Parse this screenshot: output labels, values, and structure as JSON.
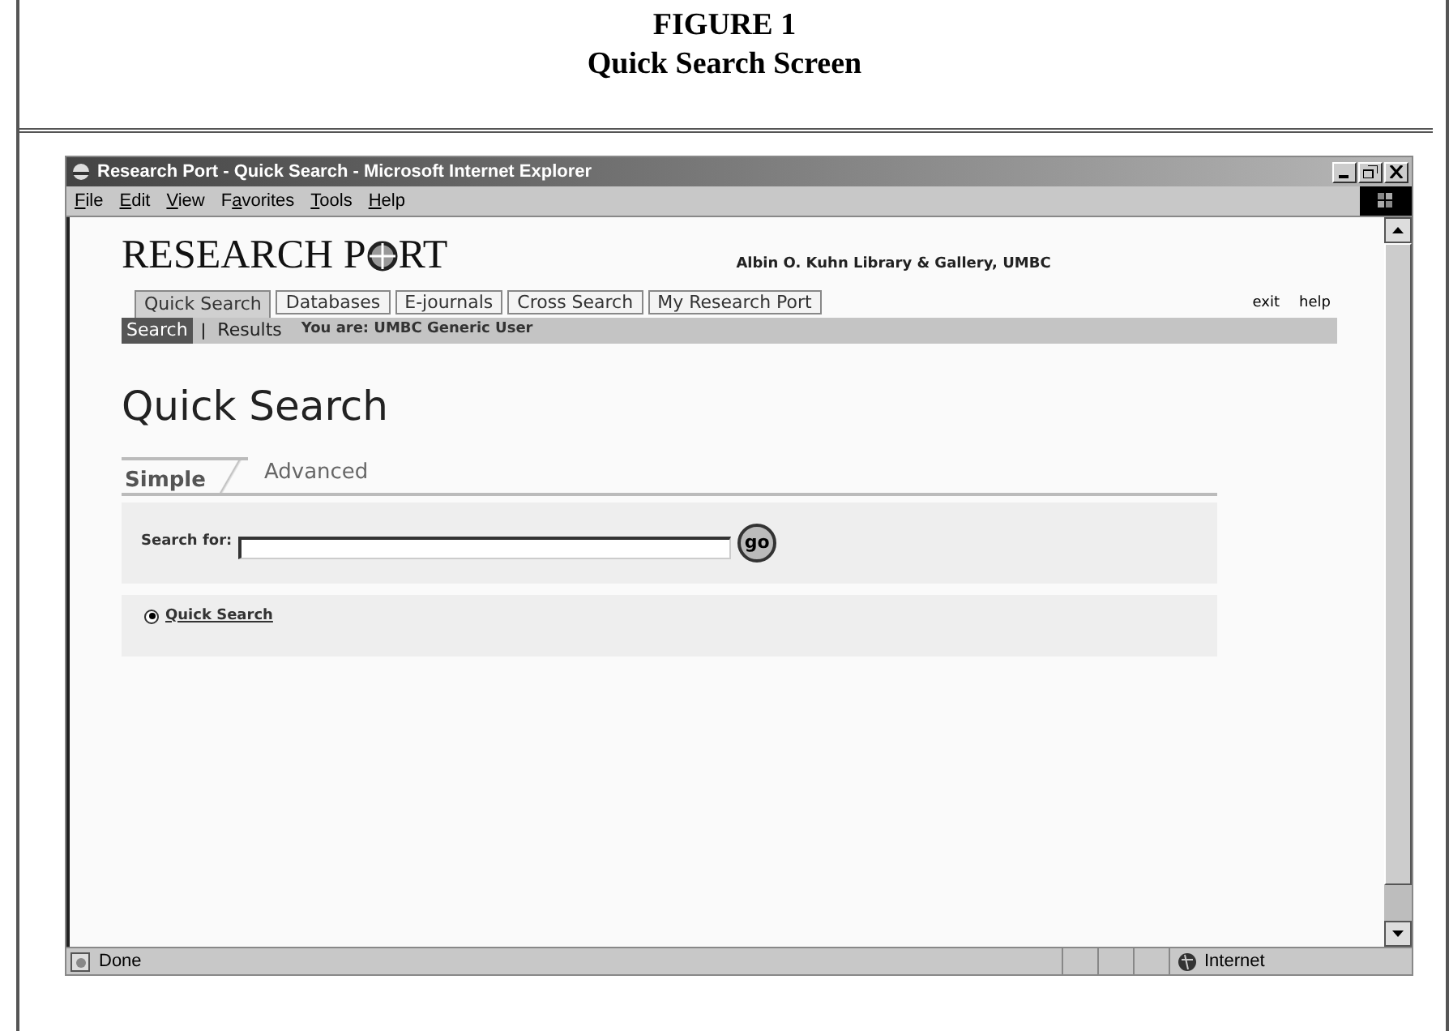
{
  "figure": {
    "number": "FIGURE 1",
    "caption": "Quick Search Screen"
  },
  "window": {
    "title": "Research Port - Quick Search - Microsoft Internet Explorer"
  },
  "menu": [
    {
      "access_key": "F",
      "rest": "ile"
    },
    {
      "access_key": "E",
      "rest": "dit"
    },
    {
      "access_key": "V",
      "rest": "iew"
    },
    {
      "before": "F",
      "access_key": "a",
      "rest": "vorites"
    },
    {
      "access_key": "T",
      "rest": "ools"
    },
    {
      "access_key": "H",
      "rest": "elp"
    }
  ],
  "logo": {
    "before": "RESEARCH P",
    "after": "RT"
  },
  "library": "Albin O. Kuhn Library & Gallery, UMBC",
  "nav_tabs": [
    {
      "label": "Quick Search",
      "selected": true
    },
    {
      "label": "Databases",
      "selected": false
    },
    {
      "label": "E-journals",
      "selected": false
    },
    {
      "label": "Cross Search",
      "selected": false
    },
    {
      "label": "My Research Port",
      "selected": false
    }
  ],
  "links": [
    "exit",
    "help"
  ],
  "subnav": {
    "items": [
      {
        "label": "Search",
        "selected": true
      },
      {
        "label": "Results",
        "selected": false
      }
    ],
    "separator": "|",
    "user": "You are: UMBC Generic User"
  },
  "heading": "Quick Search",
  "mode_tabs": [
    {
      "label": "Simple",
      "selected": true
    },
    {
      "label": "Advanced",
      "selected": false
    }
  ],
  "search": {
    "label": "Search for:",
    "button": "go"
  },
  "options": [
    {
      "label": "Quick Search",
      "selected": true
    }
  ],
  "status_bar": {
    "text": "Done",
    "zone": "Internet"
  }
}
